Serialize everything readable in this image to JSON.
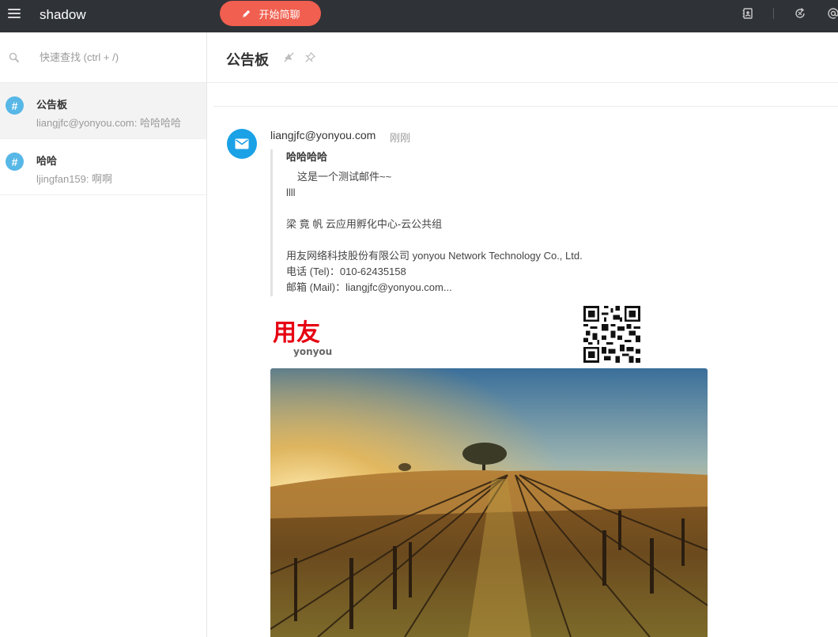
{
  "app": {
    "title": "shadow"
  },
  "topbar": {
    "start_chat_label": "开始简聊"
  },
  "sidebar": {
    "search_placeholder": "快速查找 (ctrl + /)",
    "channels": [
      {
        "name": "公告板",
        "last_message": "liangjfc@yonyou.com: 哈哈哈哈",
        "active": true
      },
      {
        "name": "哈哈",
        "last_message": "ljingfan159: 啊啊",
        "active": false
      }
    ]
  },
  "main": {
    "title": "公告板",
    "message": {
      "sender": "liangjfc@yonyou.com",
      "time": "刚刚",
      "subject": "哈哈哈哈",
      "body_line1": "这是一个测试邮件~~",
      "body_line2": "llll",
      "sig_name": "梁 竟 帆 云应用孵化中心-云公共组",
      "sig_company": "用友网络科技股份有限公司 yonyou Network Technology Co., Ltd.",
      "sig_tel": "电话 (Tel)：010-62435158",
      "sig_mail": "邮箱 (Mail)：liangjfc@yonyou.com..."
    },
    "logo": {
      "cn": "用友",
      "en": "yonyou"
    }
  },
  "colors": {
    "topbar_bg": "#2f3237",
    "accent_button": "#f05f4f",
    "channel_hash": "#57b7e6",
    "avatar_bg": "#1aa1e6",
    "logo_red": "#e60012"
  },
  "icons": [
    "menu-icon",
    "pencil-icon",
    "contacts-icon",
    "sync-icon",
    "at-icon",
    "search-icon",
    "hash-icon",
    "mute-icon",
    "pin-icon",
    "mail-icon",
    "qr-code-icon"
  ]
}
